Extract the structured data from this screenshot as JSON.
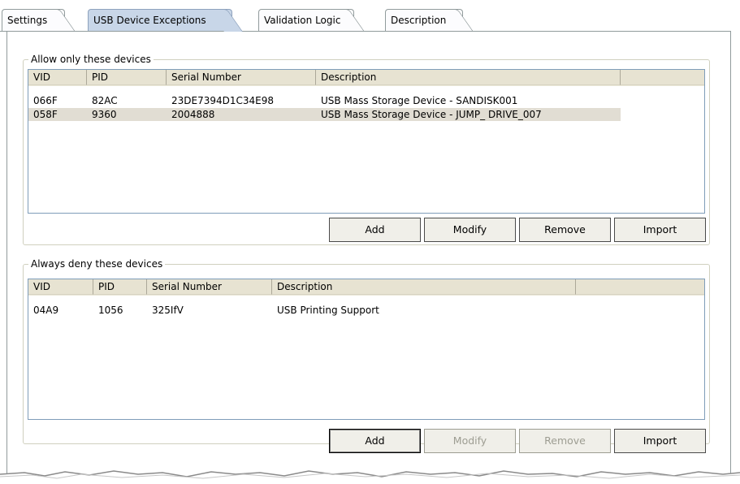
{
  "tabs": [
    {
      "label": "Settings"
    },
    {
      "label": "USB Device Exceptions"
    },
    {
      "label": "Validation Logic"
    },
    {
      "label": "Description"
    }
  ],
  "allow_group": {
    "label": "Allow only these devices",
    "columns": [
      "VID",
      "PID",
      "Serial Number",
      "Description"
    ],
    "rows": [
      {
        "vid": "066F",
        "pid": "82AC",
        "serial": "23DE7394D1C34E98",
        "description": "USB Mass Storage Device - SANDISK001"
      },
      {
        "vid": "058F",
        "pid": "9360",
        "serial": "2004888",
        "description": "USB Mass Storage Device - JUMP_ DRIVE_007"
      }
    ],
    "buttons": {
      "add": "Add",
      "modify": "Modify",
      "remove": "Remove",
      "import": "Import"
    }
  },
  "deny_group": {
    "label": "Always deny these devices",
    "columns": [
      "VID",
      "PID",
      "Serial Number",
      "Description"
    ],
    "rows": [
      {
        "vid": "04A9",
        "pid": "1056",
        "serial": "325IfV",
        "description": "USB Printing Support"
      }
    ],
    "buttons": {
      "add": "Add",
      "modify": "Modify",
      "remove": "Remove",
      "import": "Import"
    }
  },
  "colors": {
    "active_tab": "#c8d6e8",
    "selected_row": "#e1ddd3",
    "header_bg": "#e7e3d2",
    "list_border": "#7f9db9",
    "disabled_text": "#9d9d92"
  }
}
